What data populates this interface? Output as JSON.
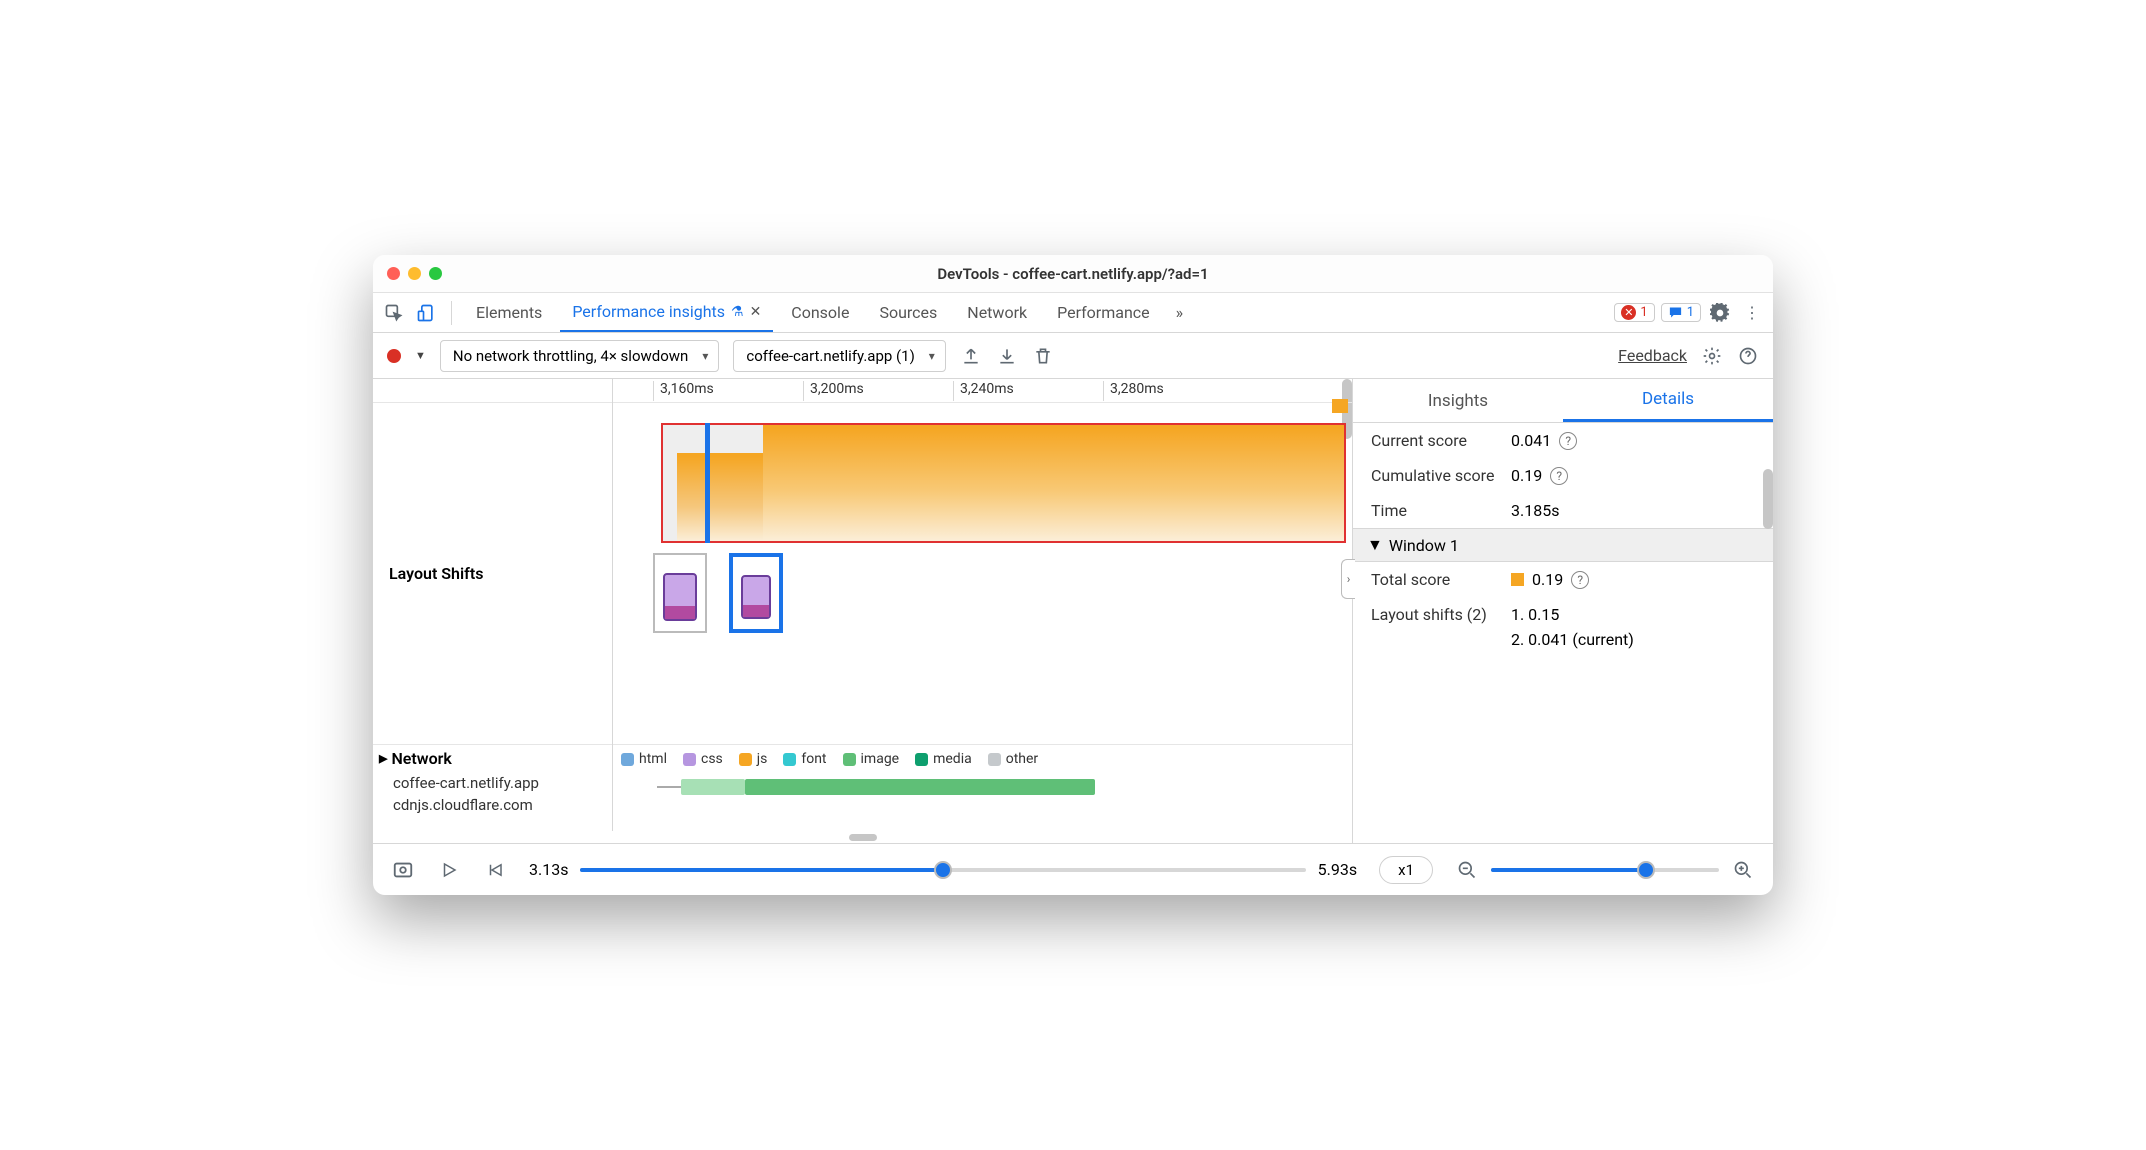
{
  "window": {
    "title": "DevTools - coffee-cart.netlify.app/?ad=1"
  },
  "tabs": {
    "elements": "Elements",
    "perf_insights": "Performance insights",
    "console": "Console",
    "sources": "Sources",
    "network": "Network",
    "performance": "Performance"
  },
  "badges": {
    "errors": "1",
    "messages": "1"
  },
  "toolbar": {
    "throttle": "No network throttling, 4× slowdown",
    "recording": "coffee-cart.netlify.app (1)",
    "feedback": "Feedback"
  },
  "ruler": {
    "t1": "3,160ms",
    "t2": "3,200ms",
    "t3": "3,240ms",
    "t4": "3,280ms"
  },
  "rows": {
    "layout_shifts": "Layout Shifts",
    "network": "Network"
  },
  "legend": {
    "html": "html",
    "css": "css",
    "js": "js",
    "font": "font",
    "image": "image",
    "media": "media",
    "other": "other"
  },
  "hosts": {
    "h1": "coffee-cart.netlify.app",
    "h2": "cdnjs.cloudflare.com"
  },
  "sidetabs": {
    "insights": "Insights",
    "details": "Details"
  },
  "details": {
    "current_score_k": "Current score",
    "current_score_v": "0.041",
    "cum_score_k": "Cumulative score",
    "cum_score_v": "0.19",
    "time_k": "Time",
    "time_v": "3.185s",
    "window_head": "Window 1",
    "total_k": "Total score",
    "total_v": "0.19",
    "ls_k": "Layout shifts (2)",
    "ls1": "1. 0.15",
    "ls2": "2. 0.041 (current)"
  },
  "footer": {
    "start": "3.13s",
    "end": "5.93s",
    "speed": "x1"
  }
}
